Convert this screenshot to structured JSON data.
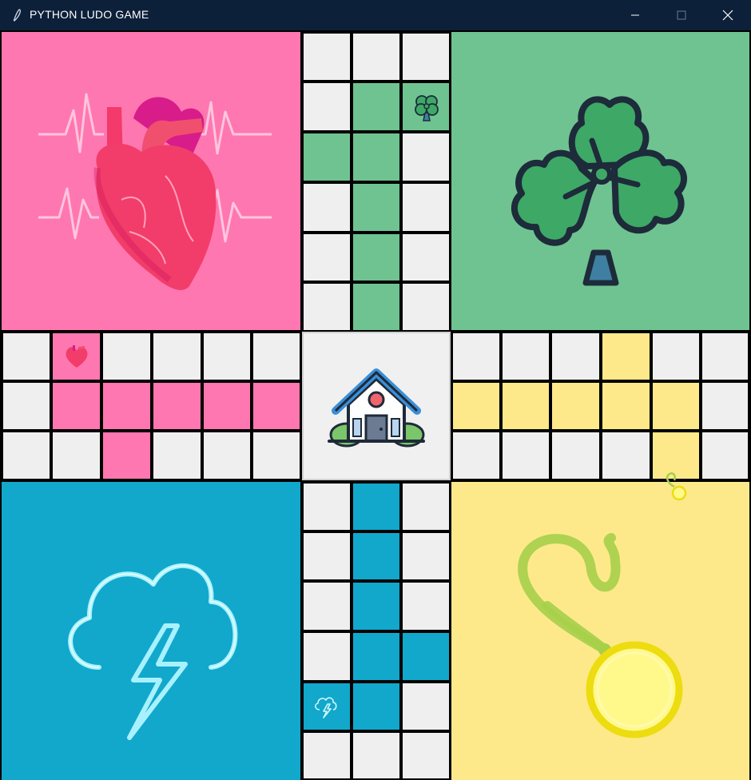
{
  "window": {
    "title": "PYTHON LUDO GAME",
    "controls": [
      "minimize",
      "maximize",
      "close"
    ]
  },
  "colors": {
    "pink": "#ff77b0",
    "green": "#6fc391",
    "blue": "#11a8cc",
    "yellow": "#fde98a",
    "white_cell": "#efefef",
    "grid": "#0a0a0a",
    "titlebar": "#0d2039"
  },
  "board": {
    "bases": [
      {
        "id": "pink",
        "icon": "heart-icon",
        "color": "#ff77b0"
      },
      {
        "id": "green",
        "icon": "clover-icon",
        "color": "#6fc391"
      },
      {
        "id": "blue",
        "icon": "storm-cloud-icon",
        "color": "#11a8cc"
      },
      {
        "id": "yellow",
        "icon": "medal-icon",
        "color": "#fde98a"
      }
    ],
    "center_icon": "home-icon",
    "tokens": [
      {
        "player": "green",
        "icon": "clover-icon"
      },
      {
        "player": "pink",
        "icon": "heart-icon"
      },
      {
        "player": "yellow",
        "icon": "medal-icon"
      },
      {
        "player": "blue",
        "icon": "storm-cloud-icon"
      }
    ]
  }
}
